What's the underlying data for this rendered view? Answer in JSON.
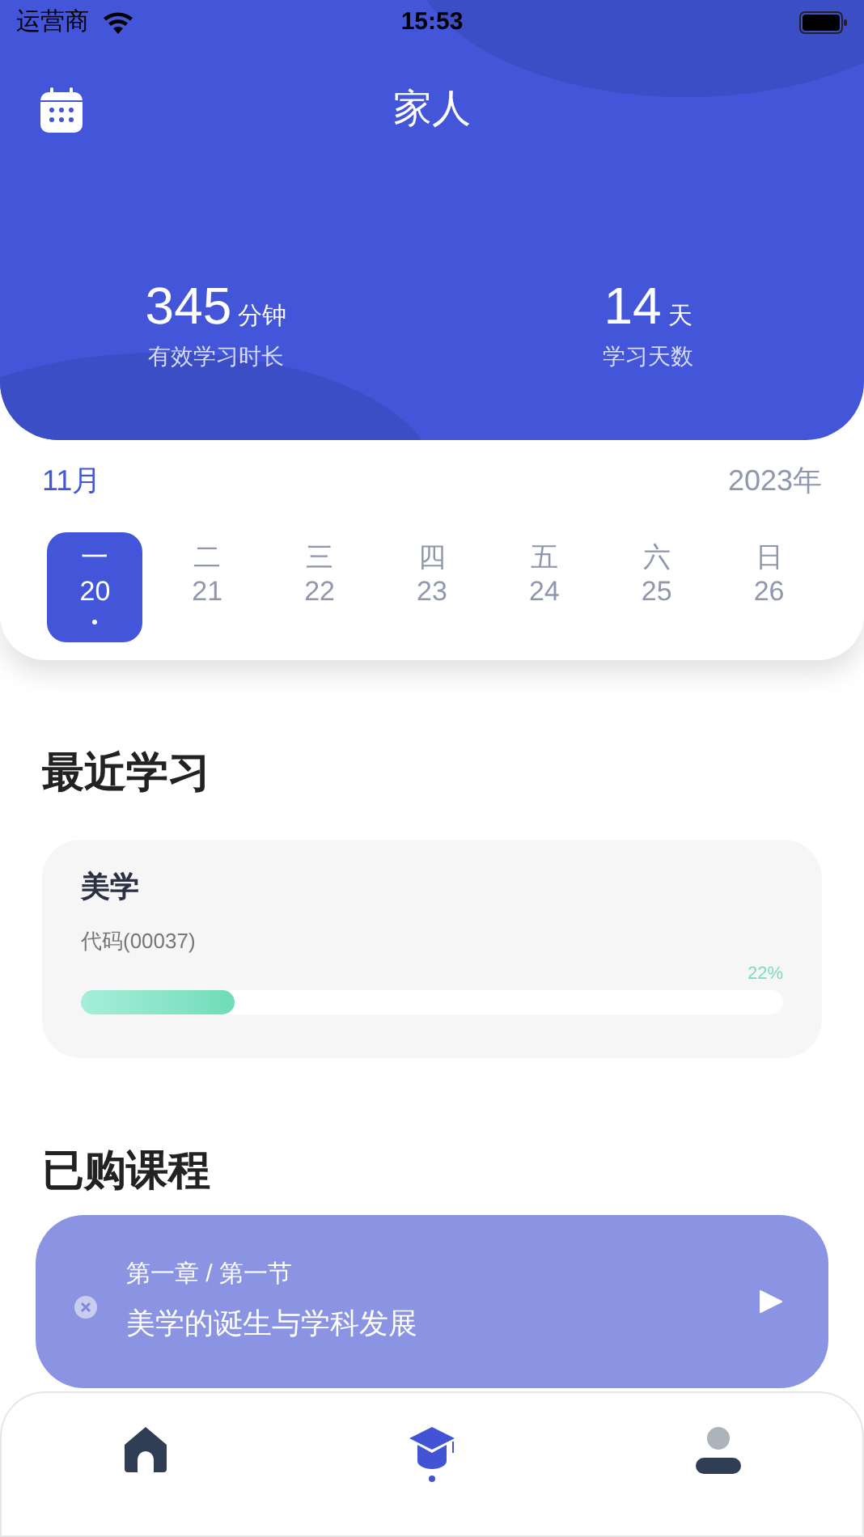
{
  "status_bar": {
    "carrier": "运营商",
    "time": "15:53"
  },
  "header": {
    "title": "家人"
  },
  "stats": [
    {
      "value": "345",
      "unit": "分钟",
      "label": "有效学习时长"
    },
    {
      "value": "14",
      "unit": "天",
      "label": "学习天数"
    }
  ],
  "calendar": {
    "month": "11月",
    "year": "2023年",
    "days": [
      {
        "weekday": "一",
        "date": "20",
        "selected": true
      },
      {
        "weekday": "二",
        "date": "21",
        "selected": false
      },
      {
        "weekday": "三",
        "date": "22",
        "selected": false
      },
      {
        "weekday": "四",
        "date": "23",
        "selected": false
      },
      {
        "weekday": "五",
        "date": "24",
        "selected": false
      },
      {
        "weekday": "六",
        "date": "25",
        "selected": false
      },
      {
        "weekday": "日",
        "date": "26",
        "selected": false
      }
    ]
  },
  "recent": {
    "heading": "最近学习",
    "course": {
      "title": "美学",
      "code": "代码(00037)",
      "percent": "22%",
      "level": 0.22
    }
  },
  "purchased": {
    "heading": "已购课程"
  },
  "mini_player": {
    "chapter": "第一章 / 第一节",
    "lesson": "美学的诞生与学科发展"
  },
  "nav": [
    {
      "kind": "home",
      "selected": false
    },
    {
      "kind": "courses",
      "selected": true
    },
    {
      "kind": "profile",
      "selected": false
    }
  ]
}
